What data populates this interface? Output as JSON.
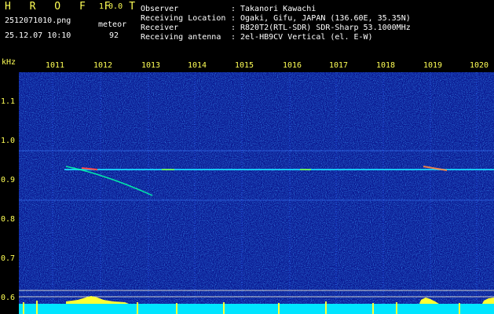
{
  "app": {
    "name": "H R O F F T",
    "version": "1.0.0"
  },
  "file": {
    "name": "2512071010.png",
    "datetime": "25.12.07 10:10"
  },
  "counter": {
    "label": "meteor",
    "value": "92"
  },
  "station": [
    {
      "key": "Observer",
      "value": "Takanori Kawachi"
    },
    {
      "key": "Receiving Location",
      "value": "Ogaki, Gifu, JAPAN (136.60E, 35.35N)"
    },
    {
      "key": "Receiver",
      "value": "R820T2(RTL-SDR) SDR-Sharp 53.1000MHz"
    },
    {
      "key": "Receiving antenna",
      "value": "2el-HB9CV Vertical (el. E-W)"
    }
  ],
  "time_axis": {
    "labels": [
      "1011",
      "1012",
      "1013",
      "1014",
      "1015",
      "1016",
      "1017",
      "1018",
      "1019",
      "1020"
    ]
  },
  "freq_axis": {
    "unit": "kHz",
    "labels": [
      "1.1",
      "1.0",
      "0.9",
      "0.8",
      "0.7",
      "0.6"
    ]
  },
  "colors": {
    "background": "#000000",
    "noise": "#0a1a9a",
    "accent": "#ffff55",
    "text": "#ffffff",
    "power_bar": "#ffff33",
    "base_bar": "#00e5ff"
  }
}
